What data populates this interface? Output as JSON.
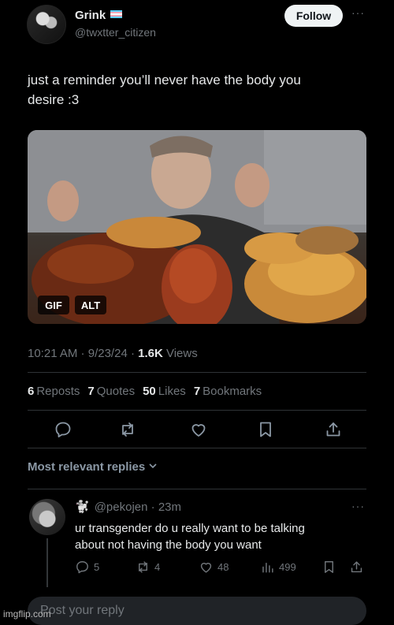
{
  "post": {
    "author_name": "Grink",
    "author_handle": "@twxtter_citizen",
    "follow_label": "Follow",
    "more_label": "···",
    "text_line1": "just a reminder you’ll never have the body you",
    "text_line2": "desire :3",
    "media": {
      "gif_label": "GIF",
      "alt_label": "ALT"
    },
    "time": "10:21 AM",
    "date": "9/23/24",
    "views_count": "1.6K",
    "views_label": "Views",
    "reposts_count": "6",
    "reposts_label": "Reposts",
    "quotes_count": "7",
    "quotes_label": "Quotes",
    "likes_count": "50",
    "likes_label": "Likes",
    "bookmarks_count": "7",
    "bookmarks_label": "Bookmarks",
    "actions": [
      "reply-icon",
      "repost-icon",
      "like-icon",
      "bookmark-icon",
      "share-icon"
    ]
  },
  "replies": {
    "sort_label": "Most relevant replies",
    "items": [
      {
        "handle": "@pekojen",
        "age": "23m",
        "text_line1": "ur transgender do u really want to be talking",
        "text_line2": "about not having the body you want",
        "reply_count": "5",
        "repost_count": "4",
        "like_count": "48",
        "views_count": "499"
      }
    ]
  },
  "reply_box": {
    "placeholder": "Post your reply"
  },
  "watermark": "imgflip.com",
  "colors": {
    "background": "#000000",
    "text": "#e7e9ea",
    "muted": "#71767b",
    "divider": "#2f3336"
  }
}
